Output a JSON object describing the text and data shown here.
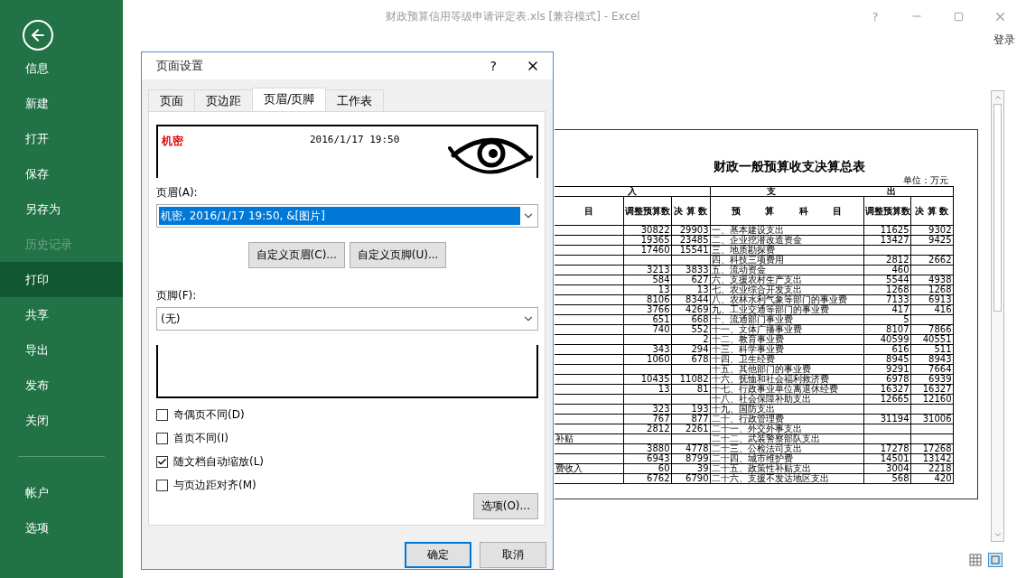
{
  "window": {
    "title": "财政预算信用等级申请评定表.xls  [兼容模式] - Excel",
    "help": "?",
    "account": "登录"
  },
  "sidebar": {
    "items": [
      {
        "label": "信息",
        "selected": false,
        "disabled": false
      },
      {
        "label": "新建",
        "selected": false,
        "disabled": false
      },
      {
        "label": "打开",
        "selected": false,
        "disabled": false
      },
      {
        "label": "保存",
        "selected": false,
        "disabled": false
      },
      {
        "label": "另存为",
        "selected": false,
        "disabled": false
      },
      {
        "label": "历史记录",
        "selected": false,
        "disabled": true
      },
      {
        "label": "打印",
        "selected": true,
        "disabled": false
      },
      {
        "label": "共享",
        "selected": false,
        "disabled": false
      },
      {
        "label": "导出",
        "selected": false,
        "disabled": false
      },
      {
        "label": "发布",
        "selected": false,
        "disabled": false
      },
      {
        "label": "关闭",
        "selected": false,
        "disabled": false
      }
    ],
    "bottom_items": [
      {
        "label": "帐户",
        "selected": false,
        "disabled": false
      },
      {
        "label": "选项",
        "selected": false,
        "disabled": false
      }
    ]
  },
  "preview": {
    "title": "财政一般预算收支决算总表",
    "unit": "单位：万元",
    "group_headers": [
      "入",
      "支",
      "出"
    ],
    "columns": [
      "目",
      "调整预算数",
      "决 算 数",
      "预 算 科 目",
      "调整预算数",
      "决 算 数"
    ],
    "rows": [
      {
        "budget": "30822",
        "actual": "29903",
        "item": "一、基本建设支出",
        "item_budget": "11625",
        "item_actual": "9302"
      },
      {
        "budget": "19365",
        "actual": "23485",
        "item": "二、企业挖潜改造资金",
        "item_budget": "13427",
        "item_actual": "9425"
      },
      {
        "budget": "17460",
        "actual": "15541",
        "item": "三、地质勘探费"
      },
      {
        "item": "四、科技三项费用",
        "item_budget": "2812",
        "item_actual": "2662"
      },
      {
        "budget": "3213",
        "actual": "3833",
        "item": "五、流动资金",
        "item_budget": "460"
      },
      {
        "budget": "584",
        "actual": "627",
        "item": "六、支援农村生产支出",
        "item_budget": "5544",
        "item_actual": "4938"
      },
      {
        "budget": "13",
        "actual": "13",
        "item": "七、农业综合开发支出",
        "item_budget": "1268",
        "item_actual": "1268"
      },
      {
        "budget": "8106",
        "actual": "8344",
        "item": "八、农林水利气象等部门的事业费",
        "item_budget": "7133",
        "item_actual": "6913"
      },
      {
        "budget": "3766",
        "actual": "4269",
        "item": "九、工业交通等部门的事业费",
        "item_budget": "417",
        "item_actual": "416"
      },
      {
        "budget": "651",
        "actual": "668",
        "item": "十、流通部门事业费",
        "item_budget": "5"
      },
      {
        "budget": "740",
        "actual": "552",
        "item": "十一、文体广播事业费",
        "item_budget": "8107",
        "item_actual": "7866"
      },
      {
        "actual": "2",
        "item": "十二、教育事业费",
        "item_budget": "40599",
        "item_actual": "40551"
      },
      {
        "budget": "343",
        "actual": "294",
        "item": "十三、科学事业费",
        "item_budget": "616",
        "item_actual": "511"
      },
      {
        "budget": "1060",
        "actual": "678",
        "item": "十四、卫生经费",
        "item_budget": "8945",
        "item_actual": "8943"
      },
      {
        "item": "十五、其他部门的事业费",
        "item_budget": "9291",
        "item_actual": "7664"
      },
      {
        "budget": "10435",
        "actual": "11082",
        "item": "十六、抚恤和社会福利救济费",
        "item_budget": "6978",
        "item_actual": "6939"
      },
      {
        "budget": "13",
        "actual": "81",
        "item": "十七、行政事业单位离退休经费",
        "item_budget": "16327",
        "item_actual": "16327"
      },
      {
        "item": "十八、社会保障补助支出",
        "item_budget": "12665",
        "item_actual": "12160"
      },
      {
        "budget": "323",
        "actual": "193",
        "item": "十九、国防支出"
      },
      {
        "budget": "767",
        "actual": "877",
        "item": "二十、行政管理费",
        "item_budget": "31194",
        "item_actual": "31006"
      },
      {
        "budget": "2812",
        "actual": "2261",
        "item": "二十一、外交外事支出"
      },
      {
        "col_1": "补贴",
        "item": "二十二、武装警察部队支出"
      },
      {
        "budget": "3880",
        "actual": "4778",
        "item": "二十三、公检法司支出",
        "item_budget": "17278",
        "item_actual": "17268"
      },
      {
        "budget": "6943",
        "actual": "8799",
        "item": "二十四、城市维护费",
        "item_budget": "14501",
        "item_actual": "13142"
      },
      {
        "col_1": "费收入",
        "budget": "60",
        "actual": "39",
        "item": "二十五、政策性补贴支出",
        "item_budget": "3004",
        "item_actual": "2218"
      },
      {
        "budget": "6762",
        "actual": "6790",
        "item": "二十六、支援不发达地区支出",
        "item_budget": "568",
        "item_actual": "420"
      }
    ]
  },
  "dialog": {
    "title": "页面设置",
    "help": "?",
    "tabs": [
      {
        "label": "页面",
        "selected": false
      },
      {
        "label": "页边距",
        "selected": false
      },
      {
        "label": "页眉/页脚",
        "selected": true
      },
      {
        "label": "工作表",
        "selected": false
      }
    ],
    "header_preview": {
      "left": "机密",
      "center": "2016/1/17 19:50"
    },
    "header_label": "页眉(A):",
    "header_field": {
      "value": "机密, 2016/1/17 19:50, &[图片]",
      "highlighted": true
    },
    "buttons": [
      "自定义页眉(C)...",
      "自定义页脚(U)..."
    ],
    "footer_label": "页脚(F):",
    "footer_field": {
      "value": "(无)",
      "highlighted": false
    },
    "checkboxes": [
      {
        "label": "奇偶页不同(D)",
        "checked": false
      },
      {
        "label": "首页不同(I)",
        "checked": false
      },
      {
        "label": "随文档自动缩放(L)",
        "checked": true
      },
      {
        "label": "与页边距对齐(M)",
        "checked": false
      }
    ],
    "options_button": "选项(O)...",
    "ok": "确定",
    "cancel": "取消"
  }
}
